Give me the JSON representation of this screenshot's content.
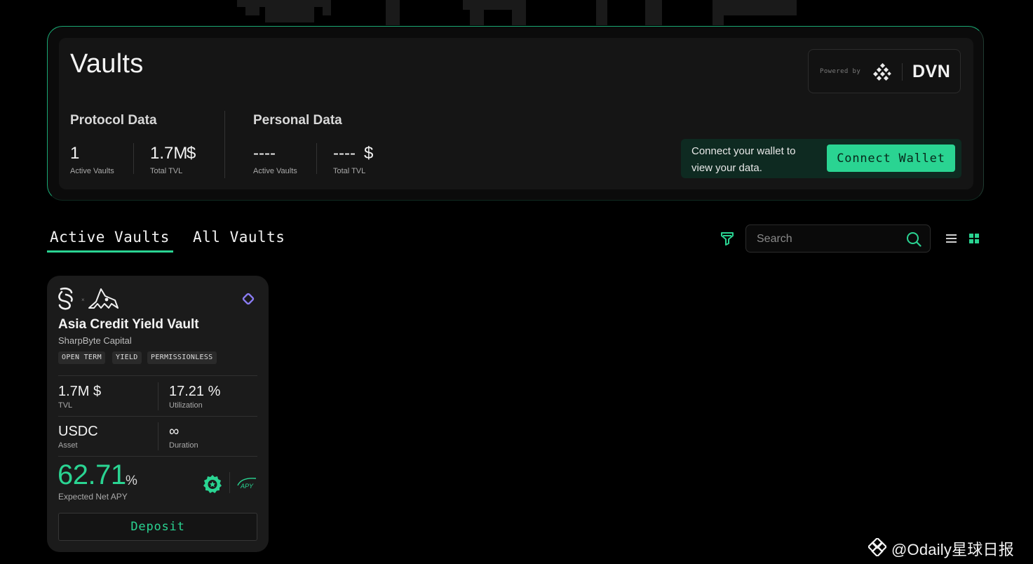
{
  "header": {
    "title": "Vaults",
    "powered_by": {
      "label": "Powered by",
      "brand": "DVN",
      "icon": "dvn-logo-icon"
    },
    "protocol": {
      "title": "Protocol Data",
      "active_vaults": {
        "value": "1",
        "label": "Active Vaults"
      },
      "total_tvl": {
        "value": "1.7M",
        "unit": "$",
        "label": "Total TVL"
      }
    },
    "personal": {
      "title": "Personal Data",
      "active_vaults": {
        "value": "----",
        "label": "Active Vaults"
      },
      "total_tvl": {
        "value": "----",
        "unit": "$",
        "label": "Total TVL"
      }
    },
    "connect": {
      "text": "Connect your wallet to view your data.",
      "button": "Connect Wallet"
    }
  },
  "tabs": [
    {
      "label": "Active Vaults",
      "active": true
    },
    {
      "label": "All Vaults",
      "active": false
    }
  ],
  "toolbar": {
    "filter_icon": "filter-icon",
    "search_placeholder": "Search",
    "search_value": "",
    "view": "grid"
  },
  "vaults": [
    {
      "title": "Asia Credit Yield Vault",
      "manager": "SharpByte Capital",
      "tags": [
        "OPEN TERM",
        "YIELD",
        "PERMISSIONLESS"
      ],
      "tvl": {
        "value": "1.7M $",
        "label": "TVL"
      },
      "utilization": {
        "value": "17.21 %",
        "label": "Utilization"
      },
      "asset": {
        "value": "USDC",
        "label": "Asset"
      },
      "duration": {
        "value": "∞",
        "label": "Duration"
      },
      "apy": {
        "value": "62.71",
        "unit": "%",
        "label": "Expected Net APY"
      },
      "apy_badge_text": "APY",
      "deposit_label": "Deposit"
    }
  ],
  "watermark": {
    "text": "@Odaily星球日报"
  },
  "colors": {
    "accent": "#2ad492",
    "background": "#000000",
    "panel": "#151515",
    "card": "#1b1b1b"
  }
}
